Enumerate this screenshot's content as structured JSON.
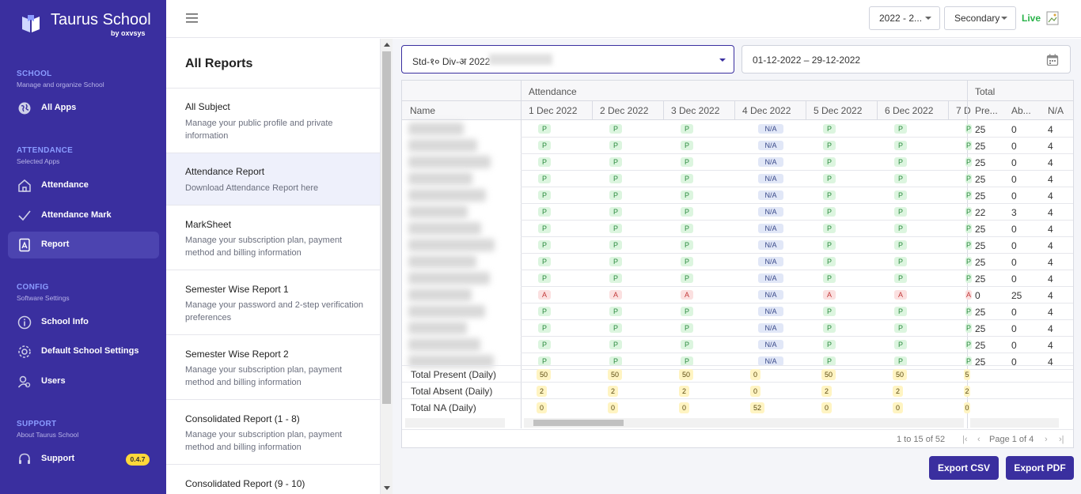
{
  "brand": {
    "title": "Taurus School",
    "sub": "by oxvsys"
  },
  "sidebar": {
    "sections": [
      {
        "head": "SCHOOL",
        "sub": "Manage and organize School"
      },
      {
        "head": "ATTENDANCE",
        "sub": "Selected Apps"
      },
      {
        "head": "CONFIG",
        "sub": "Software Settings"
      },
      {
        "head": "SUPPORT",
        "sub": "About Taurus School"
      }
    ],
    "items": [
      {
        "label": "All Apps",
        "icon": "globe-icon"
      },
      {
        "label": "Attendance",
        "icon": "home-icon"
      },
      {
        "label": "Attendance Mark",
        "icon": "check-icon"
      },
      {
        "label": "Report",
        "icon": "report-icon"
      },
      {
        "label": "School Info",
        "icon": "info-icon"
      },
      {
        "label": "Default School Settings",
        "icon": "gear-icon"
      },
      {
        "label": "Users",
        "icon": "users-icon"
      },
      {
        "label": "Support",
        "icon": "headset-icon"
      }
    ],
    "version": "0.4.7"
  },
  "topbar": {
    "year": "2022 - 2...",
    "level": "Secondary",
    "live": "Live"
  },
  "reports": {
    "title": "All Reports",
    "items": [
      {
        "title": "All Subject",
        "desc": "Manage your public profile and private information"
      },
      {
        "title": "Attendance Report",
        "desc": "Download Attendance Report here"
      },
      {
        "title": "MarkSheet",
        "desc": "Manage your subscription plan, payment method and billing information"
      },
      {
        "title": "Semester Wise Report 1",
        "desc": "Manage your password and 2-step verification preferences"
      },
      {
        "title": "Semester Wise Report 2",
        "desc": "Manage your subscription plan, payment method and billing information"
      },
      {
        "title": "Consolidated Report (1 - 8)",
        "desc": "Manage your subscription plan, payment method and billing information"
      },
      {
        "title": "Consolidated Report (9 - 10)",
        "desc": ""
      }
    ]
  },
  "filters": {
    "std": "Std-१० Div-अ 2022",
    "dates": "01-12-2022 – 29-12-2022"
  },
  "grid": {
    "group_attendance": "Attendance",
    "group_total": "Total",
    "name_header": "Name",
    "date_headers": [
      "1 Dec 2022",
      "2 Dec 2022",
      "3 Dec 2022",
      "4 Dec 2022",
      "5 Dec 2022",
      "6 Dec 2022",
      "7 D"
    ],
    "total_headers": [
      "Pre...",
      "Ab...",
      "N/A"
    ],
    "rows": [
      {
        "status": "P",
        "pre": "25",
        "ab": "0",
        "na": "4"
      },
      {
        "status": "P",
        "pre": "25",
        "ab": "0",
        "na": "4"
      },
      {
        "status": "P",
        "pre": "25",
        "ab": "0",
        "na": "4"
      },
      {
        "status": "P",
        "pre": "25",
        "ab": "0",
        "na": "4"
      },
      {
        "status": "P",
        "pre": "25",
        "ab": "0",
        "na": "4"
      },
      {
        "status": "P",
        "pre": "22",
        "ab": "3",
        "na": "4"
      },
      {
        "status": "P",
        "pre": "25",
        "ab": "0",
        "na": "4"
      },
      {
        "status": "P",
        "pre": "25",
        "ab": "0",
        "na": "4"
      },
      {
        "status": "P",
        "pre": "25",
        "ab": "0",
        "na": "4"
      },
      {
        "status": "P",
        "pre": "25",
        "ab": "0",
        "na": "4"
      },
      {
        "status": "A",
        "pre": "0",
        "ab": "25",
        "na": "4"
      },
      {
        "status": "P",
        "pre": "25",
        "ab": "0",
        "na": "4"
      },
      {
        "status": "P",
        "pre": "25",
        "ab": "0",
        "na": "4"
      },
      {
        "status": "P",
        "pre": "25",
        "ab": "0",
        "na": "4"
      },
      {
        "status": "P",
        "pre": "25",
        "ab": "0",
        "na": "4"
      }
    ],
    "na_label": "N/A",
    "footer": [
      {
        "label": "Total Present (Daily)",
        "values": [
          "50",
          "50",
          "50",
          "0",
          "50",
          "50",
          "5"
        ]
      },
      {
        "label": "Total Absent (Daily)",
        "values": [
          "2",
          "2",
          "2",
          "0",
          "2",
          "2",
          "2"
        ]
      },
      {
        "label": "Total NA (Daily)",
        "values": [
          "0",
          "0",
          "0",
          "52",
          "0",
          "0",
          "0"
        ]
      }
    ],
    "pager_info": "1 to 15 of 52",
    "pager_page": "Page 1 of 4"
  },
  "actions": {
    "export_csv": "Export CSV",
    "export_pdf": "Export PDF"
  },
  "colors": {
    "sidebar": "#3a2f9f",
    "accent": "#3a2f9f",
    "live": "#2ab34a"
  }
}
